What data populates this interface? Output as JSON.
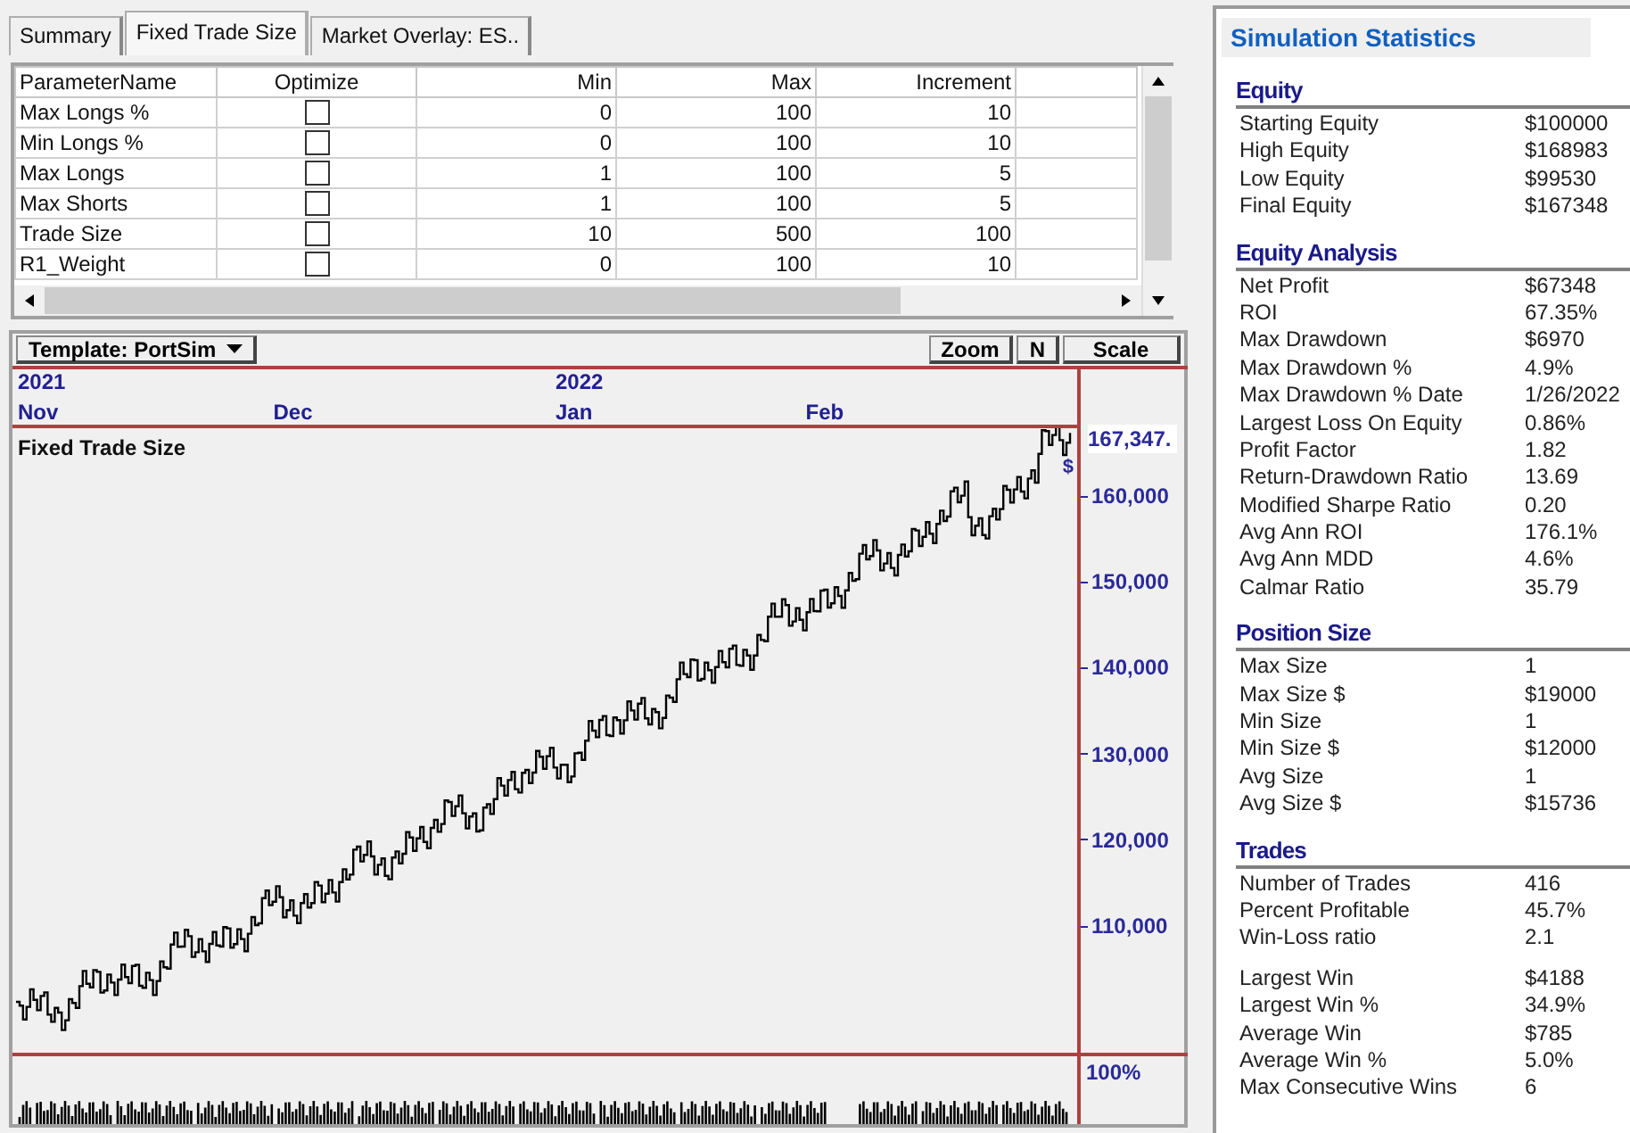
{
  "tabs": [
    {
      "label": "Summary",
      "selected": false
    },
    {
      "label": "Fixed Trade Size",
      "selected": true
    },
    {
      "label": "Market Overlay: ES..",
      "selected": false
    }
  ],
  "parameters": {
    "columns": [
      "ParameterName",
      "Optimize",
      "Min",
      "Max",
      "Increment"
    ],
    "rows": [
      {
        "name": "Max Longs %",
        "optimize": false,
        "min": "0",
        "max": "100",
        "increment": "10"
      },
      {
        "name": "Min Longs %",
        "optimize": false,
        "min": "0",
        "max": "100",
        "increment": "10"
      },
      {
        "name": "Max Longs",
        "optimize": false,
        "min": "1",
        "max": "100",
        "increment": "5"
      },
      {
        "name": "Max Shorts",
        "optimize": false,
        "min": "1",
        "max": "100",
        "increment": "5"
      },
      {
        "name": "Trade Size",
        "optimize": false,
        "min": "10",
        "max": "500",
        "increment": "100"
      },
      {
        "name": "R1_Weight",
        "optimize": false,
        "min": "0",
        "max": "100",
        "increment": "10"
      }
    ]
  },
  "chart": {
    "template": "Template: PortSim",
    "buttons": [
      "Zoom",
      "N",
      "Scale"
    ],
    "years": [
      "2021",
      "2022"
    ],
    "months": [
      "Nov",
      "Dec",
      "Jan",
      "Feb"
    ],
    "title": "Fixed Trade Size",
    "last_value": "167,347.",
    "marker": "$",
    "y_ticks": [
      "160,000",
      "150,000",
      "140,000",
      "130,000",
      "120,000",
      "110,000"
    ],
    "volume_label": "100%"
  },
  "stats": {
    "title": "Simulation Statistics",
    "sections": [
      {
        "title": "Equity",
        "groups": [
          [
            {
              "label": "Starting Equity",
              "value": "$100000"
            },
            {
              "label": "High Equity",
              "value": "$168983"
            },
            {
              "label": "Low Equity",
              "value": "$99530"
            },
            {
              "label": "Final Equity",
              "value": "$167348"
            }
          ]
        ]
      },
      {
        "title": "Equity Analysis",
        "groups": [
          [
            {
              "label": "Net Profit",
              "value": "$67348"
            },
            {
              "label": "ROI",
              "value": "67.35%"
            },
            {
              "label": "Max Drawdown",
              "value": "$6970"
            },
            {
              "label": "Max Drawdown %",
              "value": "4.9%"
            },
            {
              "label": "Max Drawdown % Date",
              "value": "1/26/2022"
            },
            {
              "label": "Largest Loss On Equity",
              "value": "0.86%"
            },
            {
              "label": "Profit Factor",
              "value": "1.82"
            },
            {
              "label": "Return-Drawdown Ratio",
              "value": "13.69"
            },
            {
              "label": "Modified Sharpe Ratio",
              "value": "0.20"
            },
            {
              "label": "Avg Ann ROI",
              "value": "176.1%"
            },
            {
              "label": "Avg Ann MDD",
              "value": "4.6%"
            },
            {
              "label": "Calmar Ratio",
              "value": "35.79"
            }
          ]
        ]
      },
      {
        "title": "Position Size",
        "groups": [
          [
            {
              "label": "Max Size",
              "value": "1"
            },
            {
              "label": "Max Size $",
              "value": "$19000"
            },
            {
              "label": "Min Size",
              "value": "1"
            },
            {
              "label": "Min Size $",
              "value": "$12000"
            },
            {
              "label": "Avg Size",
              "value": "1"
            },
            {
              "label": "Avg Size $",
              "value": "$15736"
            }
          ]
        ]
      },
      {
        "title": "Trades",
        "groups": [
          [
            {
              "label": "Number of Trades",
              "value": "416"
            },
            {
              "label": "Percent Profitable",
              "value": "45.7%"
            },
            {
              "label": "Win-Loss ratio",
              "value": "2.1"
            }
          ],
          [
            {
              "label": "Largest Win",
              "value": "$4188"
            },
            {
              "label": "Largest Win %",
              "value": "34.9%"
            },
            {
              "label": "Average Win",
              "value": "$785"
            },
            {
              "label": "Average Win %",
              "value": "5.0%"
            },
            {
              "label": "Max Consecutive Wins",
              "value": "6"
            }
          ]
        ]
      }
    ]
  }
}
